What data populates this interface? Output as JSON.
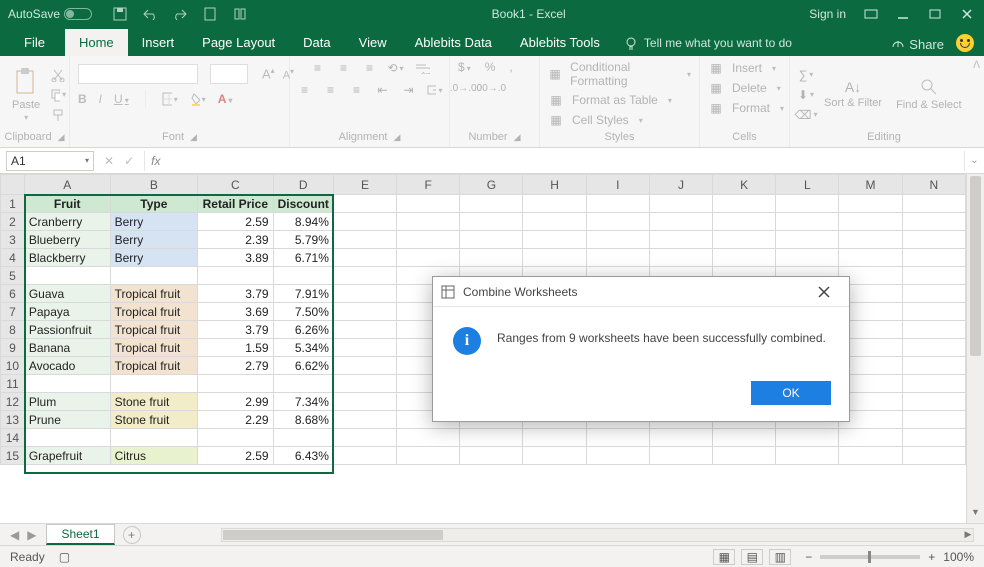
{
  "titlebar": {
    "autosave_label": "AutoSave",
    "title": "Book1 - Excel",
    "signin": "Sign in"
  },
  "tabs": {
    "file": "File",
    "home": "Home",
    "insert": "Insert",
    "pagelayout": "Page Layout",
    "data": "Data",
    "view": "View",
    "ablebits_data": "Ablebits Data",
    "ablebits_tools": "Ablebits Tools",
    "tellme": "Tell me what you want to do",
    "share": "Share"
  },
  "ribbon": {
    "clipboard": "Clipboard",
    "paste": "Paste",
    "font": "Font",
    "alignment": "Alignment",
    "number": "Number",
    "styles": "Styles",
    "cond_fmt": "Conditional Formatting",
    "fmt_as_table": "Format as Table",
    "cell_styles": "Cell Styles",
    "cells": "Cells",
    "insert_btn": "Insert",
    "delete_btn": "Delete",
    "format_btn": "Format",
    "editing": "Editing",
    "sort_filter": "Sort & Filter",
    "find_select": "Find & Select",
    "currency": "$",
    "percent": "%",
    "comma": ","
  },
  "namebox": "A1",
  "columns": [
    "A",
    "B",
    "C",
    "D",
    "E",
    "F",
    "G",
    "H",
    "I",
    "J",
    "K",
    "L",
    "M",
    "N"
  ],
  "headers": {
    "A": "Fruit",
    "B": "Type",
    "C": "Retail Price",
    "D": "Discount"
  },
  "rows": [
    {
      "n": 2,
      "A": "Cranberry",
      "B": "Berry",
      "C": "2.59",
      "D": "8.94%",
      "cls": "berry"
    },
    {
      "n": 3,
      "A": "Blueberry",
      "B": "Berry",
      "C": "2.39",
      "D": "5.79%",
      "cls": "berry"
    },
    {
      "n": 4,
      "A": "Blackberry",
      "B": "Berry",
      "C": "3.89",
      "D": "6.71%",
      "cls": "berry"
    },
    {
      "n": 5,
      "A": "",
      "B": "",
      "C": "",
      "D": "",
      "cls": ""
    },
    {
      "n": 6,
      "A": "Guava",
      "B": "Tropical fruit",
      "C": "3.79",
      "D": "7.91%",
      "cls": "trop"
    },
    {
      "n": 7,
      "A": "Papaya",
      "B": "Tropical fruit",
      "C": "3.69",
      "D": "7.50%",
      "cls": "trop"
    },
    {
      "n": 8,
      "A": "Passionfruit",
      "B": "Tropical fruit",
      "C": "3.79",
      "D": "6.26%",
      "cls": "trop"
    },
    {
      "n": 9,
      "A": "Banana",
      "B": "Tropical fruit",
      "C": "1.59",
      "D": "5.34%",
      "cls": "trop"
    },
    {
      "n": 10,
      "A": "Avocado",
      "B": "Tropical fruit",
      "C": "2.79",
      "D": "6.62%",
      "cls": "trop"
    },
    {
      "n": 11,
      "A": "",
      "B": "",
      "C": "",
      "D": "",
      "cls": ""
    },
    {
      "n": 12,
      "A": "Plum",
      "B": "Stone fruit",
      "C": "2.99",
      "D": "7.34%",
      "cls": "stone"
    },
    {
      "n": 13,
      "A": "Prune",
      "B": "Stone fruit",
      "C": "2.29",
      "D": "8.68%",
      "cls": "stone"
    },
    {
      "n": 14,
      "A": "",
      "B": "",
      "C": "",
      "D": "",
      "cls": ""
    },
    {
      "n": 15,
      "A": "Grapefruit",
      "B": "Citrus",
      "C": "2.59",
      "D": "6.43%",
      "cls": "citrus"
    }
  ],
  "sheet_tab": "Sheet1",
  "status": {
    "ready": "Ready",
    "zoom": "100%"
  },
  "dialog": {
    "title": "Combine Worksheets",
    "message": "Ranges from 9 worksheets have been successfully combined.",
    "ok": "OK"
  }
}
